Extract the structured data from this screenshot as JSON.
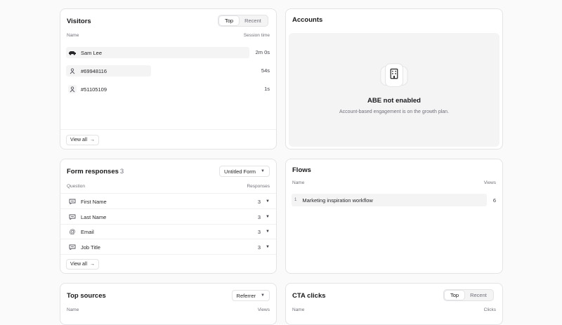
{
  "visitors": {
    "title": "Visitors",
    "tabs": [
      "Top",
      "Recent"
    ],
    "col_name": "Name",
    "col_session": "Session time",
    "rows": [
      {
        "name": "Sam Lee",
        "value": "2m 0s",
        "icon": "car-icon",
        "share": 0.92
      },
      {
        "name": "#69948116",
        "value": "54s",
        "icon": "person-icon",
        "share": 0.42
      },
      {
        "name": "#51105109",
        "value": "1s",
        "icon": "person-icon",
        "share": 0.0
      }
    ],
    "view_all": "View all"
  },
  "accounts": {
    "title": "Accounts",
    "empty_title": "ABE not enabled",
    "empty_sub": "Account-based engagement is on the growth plan.",
    "icon": "building-icon"
  },
  "form_responses": {
    "title": "Form responses",
    "count": "3",
    "dropdown": "Untitled Form",
    "col_question": "Question",
    "col_responses": "Responses",
    "rows": [
      {
        "label": "First Name",
        "value": "3",
        "icon": "chat-icon"
      },
      {
        "label": "Last Name",
        "value": "3",
        "icon": "chat-icon"
      },
      {
        "label": "Email",
        "value": "3",
        "icon": "at-icon"
      },
      {
        "label": "Job Title",
        "value": "3",
        "icon": "chat-icon"
      }
    ],
    "view_all": "View all"
  },
  "flows": {
    "title": "Flows",
    "col_name": "Name",
    "col_views": "Views",
    "rows": [
      {
        "rank": "1",
        "name": "Marketing inspiration workflow",
        "value": "6"
      }
    ]
  },
  "top_sources": {
    "title": "Top sources",
    "dropdown": "Referrer",
    "col_name": "Name",
    "col_views": "Views"
  },
  "cta_clicks": {
    "title": "CTA clicks",
    "tabs": [
      "Top",
      "Recent"
    ],
    "col_name": "Name",
    "col_clicks": "Clicks"
  }
}
